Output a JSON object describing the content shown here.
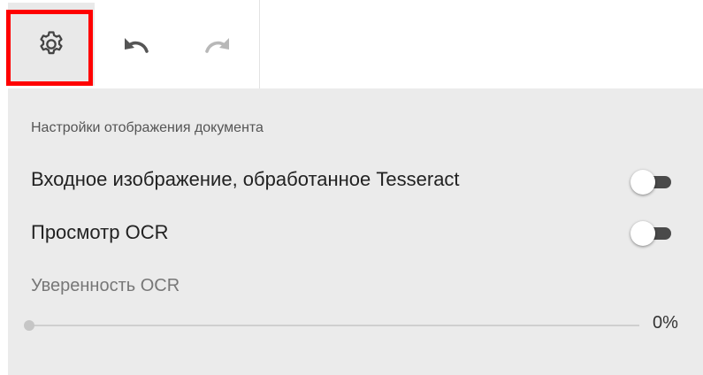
{
  "toolbar": {
    "settings_icon": "gear-icon",
    "undo_icon": "undo-icon",
    "redo_icon": "redo-icon"
  },
  "panel": {
    "title": "Настройки отображения документа",
    "options": [
      {
        "label": "Входное изображение, обработанное Tesseract",
        "enabled": false
      },
      {
        "label": "Просмотр OCR",
        "enabled": false
      }
    ],
    "confidence": {
      "label": "Уверенность OCR",
      "value_text": "0%",
      "value": 0
    }
  },
  "colors": {
    "highlight": "#ff0000",
    "panel_bg": "#ebebeb",
    "toggle_track": "#4a4a4a"
  }
}
